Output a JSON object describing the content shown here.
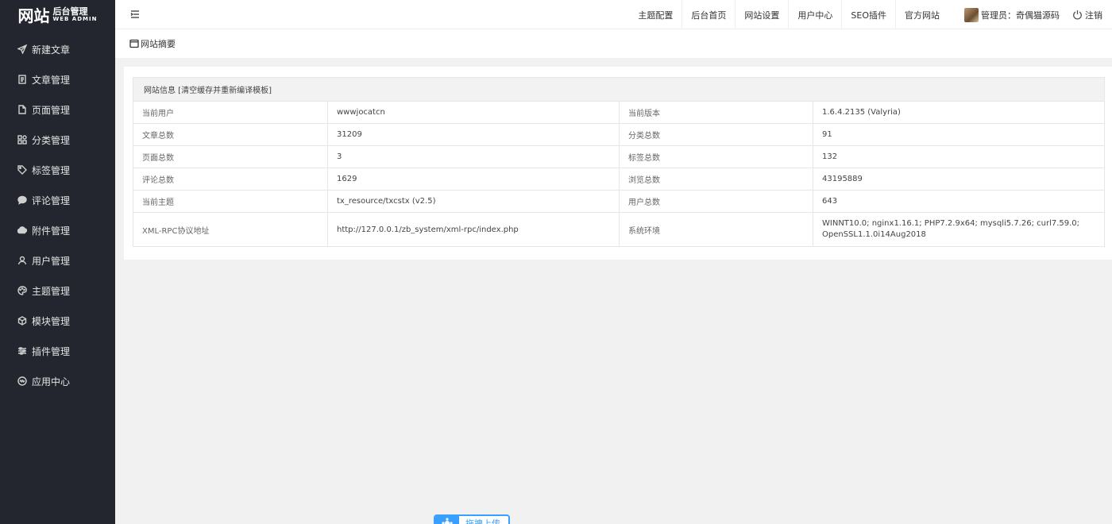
{
  "logo": {
    "main": "网站",
    "side_cn": "后台管理",
    "side_en": "WEB ADMIN"
  },
  "sidebar": {
    "items": [
      {
        "label": "新建文章",
        "icon": "send-icon"
      },
      {
        "label": "文章管理",
        "icon": "document-icon"
      },
      {
        "label": "页面管理",
        "icon": "page-icon"
      },
      {
        "label": "分类管理",
        "icon": "category-icon"
      },
      {
        "label": "标签管理",
        "icon": "tag-icon"
      },
      {
        "label": "评论管理",
        "icon": "comment-icon"
      },
      {
        "label": "附件管理",
        "icon": "cloud-icon"
      },
      {
        "label": "用户管理",
        "icon": "user-icon"
      },
      {
        "label": "主题管理",
        "icon": "palette-icon"
      },
      {
        "label": "模块管理",
        "icon": "cube-icon"
      },
      {
        "label": "插件管理",
        "icon": "sliders-icon"
      },
      {
        "label": "应用中心",
        "icon": "app-icon"
      }
    ]
  },
  "topnav": {
    "items": [
      "主题配置",
      "后台首页",
      "网站设置",
      "用户中心",
      "SEO插件",
      "官方网站"
    ],
    "user_label": "管理员：奇偶猫源码",
    "logout_label": "注销"
  },
  "subhead": {
    "title": "网站摘要"
  },
  "info": {
    "header": "网站信息 [清空缓存并重新编译模板]",
    "rows": [
      {
        "l1": "当前用户",
        "v1": "wwwjocatcn",
        "l2": "当前版本",
        "v2": "1.6.4.2135 (Valyria)"
      },
      {
        "l1": "文章总数",
        "v1": "31209",
        "l2": "分类总数",
        "v2": "91"
      },
      {
        "l1": "页面总数",
        "v1": "3",
        "l2": "标签总数",
        "v2": "132"
      },
      {
        "l1": "评论总数",
        "v1": "1629",
        "l2": "浏览总数",
        "v2": "43195889"
      },
      {
        "l1": "当前主题",
        "v1": "tx_resource/txcstx (v2.5)",
        "l2": "用户总数",
        "v2": "643"
      }
    ],
    "last_row": {
      "l1": "XML-RPC协议地址",
      "v1": "http://127.0.0.1/zb_system/xml-rpc/index.php",
      "l2": "系统环境",
      "v2_line1": "WINNT10.0; nginx1.16.1; PHP7.2.9x64; mysqli5.7.26; curl7.59.0;",
      "v2_line2": "OpenSSL1.1.0i14Aug2018"
    }
  },
  "upload": {
    "label": "拖拽上传"
  },
  "colors": {
    "sidebar_bg": "#23262e",
    "accent": "#39a0ff",
    "page_bg": "#f1f1f1"
  }
}
